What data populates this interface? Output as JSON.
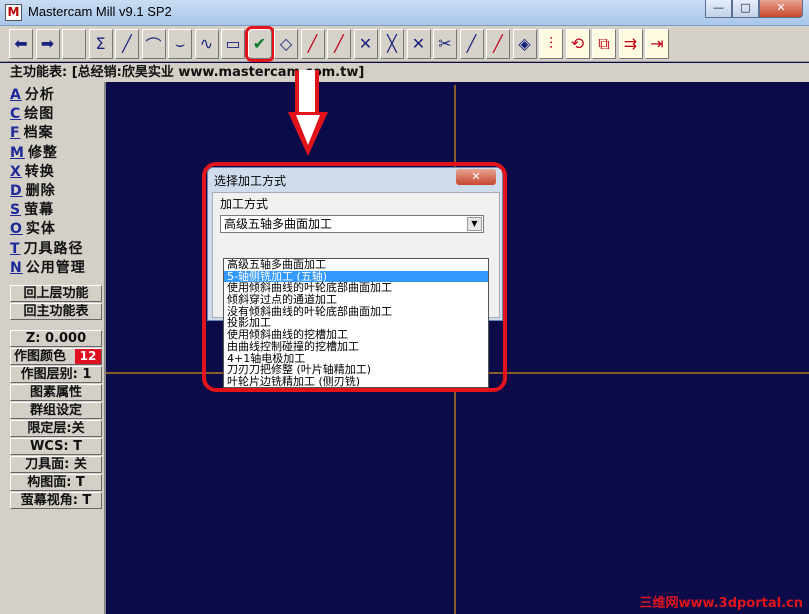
{
  "window": {
    "title": "Mastercam Mill v9.1 SP2",
    "minimize": "—",
    "maximize": "□",
    "close": "✕"
  },
  "toolbar": [
    {
      "icon": "arrow-left-icon",
      "glyph": "⬅"
    },
    {
      "icon": "arrow-right-icon",
      "glyph": "➡"
    },
    {
      "icon": "blank-icon",
      "glyph": ""
    },
    {
      "icon": "sigma-icon",
      "glyph": "Σ"
    },
    {
      "icon": "line-icon",
      "glyph": "╱"
    },
    {
      "icon": "arc-icon",
      "glyph": "⌒"
    },
    {
      "icon": "fillet-icon",
      "glyph": "⌣"
    },
    {
      "icon": "spline-icon",
      "glyph": "∿"
    },
    {
      "icon": "rectangle-icon",
      "glyph": "▭"
    },
    {
      "icon": "toolpath-select-icon",
      "glyph": "✔"
    },
    {
      "icon": "surface-icon",
      "glyph": "◇"
    },
    {
      "icon": "trim-icon",
      "glyph": "╱"
    },
    {
      "icon": "break-icon",
      "glyph": "╱"
    },
    {
      "icon": "intersect-icon",
      "glyph": "✕"
    },
    {
      "icon": "delete-entity-icon",
      "glyph": "╳"
    },
    {
      "icon": "cross-icon",
      "glyph": "✕"
    },
    {
      "icon": "scissors-icon",
      "glyph": "✂"
    },
    {
      "icon": "extend-icon",
      "glyph": "╱"
    },
    {
      "icon": "divide-icon",
      "glyph": "╱"
    },
    {
      "icon": "shade-icon",
      "glyph": "◈"
    },
    {
      "icon": "mirror-icon",
      "glyph": "⫶"
    },
    {
      "icon": "rotate-icon",
      "glyph": "⟲"
    },
    {
      "icon": "scale-icon",
      "glyph": "⧉"
    },
    {
      "icon": "translate-icon",
      "glyph": "⇉"
    },
    {
      "icon": "offset-icon",
      "glyph": "⇥"
    }
  ],
  "menubar": {
    "label": "主功能表: [总经销:欣昊实业 www.mastercam.com.tw]"
  },
  "left_menu": [
    {
      "key": "A",
      "label": "分析"
    },
    {
      "key": "C",
      "label": "绘图"
    },
    {
      "key": "F",
      "label": "档案"
    },
    {
      "key": "M",
      "label": "修整"
    },
    {
      "key": "X",
      "label": "转换"
    },
    {
      "key": "D",
      "label": "删除"
    },
    {
      "key": "S",
      "label": "萤幕"
    },
    {
      "key": "O",
      "label": "实体"
    },
    {
      "key": "T",
      "label": "刀具路径"
    },
    {
      "key": "N",
      "label": "公用管理"
    }
  ],
  "nav_buttons": {
    "up": "回上层功能",
    "main": "回主功能表"
  },
  "status": {
    "z": "Z:  0.000",
    "color_label": "作图颜色",
    "color_value": "12",
    "color_hex": "#e01020",
    "level": "作图层别:  1",
    "attributes": "图素属性",
    "group": "群组设定",
    "mask": "限定层:关",
    "wcs": "WCS:  T",
    "tool_plane": "刀具面: 关",
    "construction_plane": "构图面: T",
    "view": "萤幕视角: T"
  },
  "dialog": {
    "title": "选择加工方式",
    "close": "✕",
    "group_label": "加工方式",
    "selected_value": "高级五轴多曲面加工",
    "options": [
      "高级五轴多曲面加工",
      "5-轴侧铣加工 (五轴)",
      "使用倾斜曲线的叶轮底部曲面加工",
      "倾斜穿过点的通道加工",
      "没有倾斜曲线的叶轮底部曲面加工",
      "投影加工",
      "使用倾斜曲线的挖槽加工",
      "由曲线控制碰撞的挖槽加工",
      "4+1轴电极加工",
      "刀刃刀把修整 (叶片轴精加工)",
      "叶轮片边铣精加工 (侧刃铣)"
    ],
    "highlighted_index": 1
  },
  "watermark": "三维网www.3dportal.cn",
  "colors": {
    "background": "#0b0b4a",
    "annotation": "#e1141c",
    "panel": "#d4d0c8",
    "selection": "#3399ff"
  }
}
